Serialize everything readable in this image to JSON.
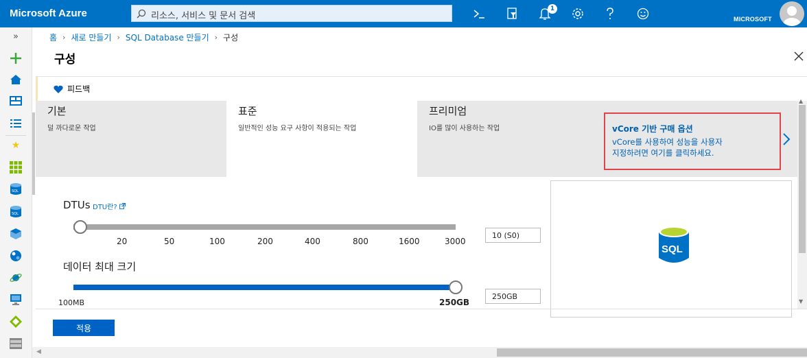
{
  "app": {
    "brand": "Microsoft Azure",
    "account": "MICROSOFT"
  },
  "search": {
    "placeholder": "리소스, 서비스 및 문서 검색"
  },
  "topbar": {
    "notification_count": "1"
  },
  "breadcrumb": {
    "items": [
      "홈",
      "새로 만들기",
      "SQL Database 만들기",
      "구성"
    ]
  },
  "blade": {
    "title": "구성",
    "feedback_label": "피드백"
  },
  "tiers": [
    {
      "name": "기본",
      "desc": "덜 까다로운 작업"
    },
    {
      "name": "표준",
      "desc": "일반적인 성능 요구 사항이 적용되는 작업",
      "active": true
    },
    {
      "name": "프리미엄",
      "desc": "IO를 많이 사용하는 작업"
    }
  ],
  "vcore": {
    "title": "vCore 기반 구매 옵션",
    "desc_line1": "vCore를 사용하여 성능을 사용자",
    "desc_line2": "지정하려면 여기를 클릭하세요."
  },
  "dtu": {
    "label": "DTUs",
    "link": "DTU란?",
    "ticks": [
      "20",
      "50",
      "100",
      "200",
      "400",
      "800",
      "1600",
      "3000"
    ],
    "value": "10 (S0)",
    "slider_fraction": 0
  },
  "size": {
    "label": "데이터 최대 크기",
    "min": "100MB",
    "max": "250GB",
    "value": "250GB",
    "slider_fraction": 1
  },
  "actions": {
    "apply": "적용"
  },
  "colors": {
    "azure_blue": "#0072c6",
    "slider_blue": "#0062c4",
    "highlight_red": "#e0444a"
  }
}
